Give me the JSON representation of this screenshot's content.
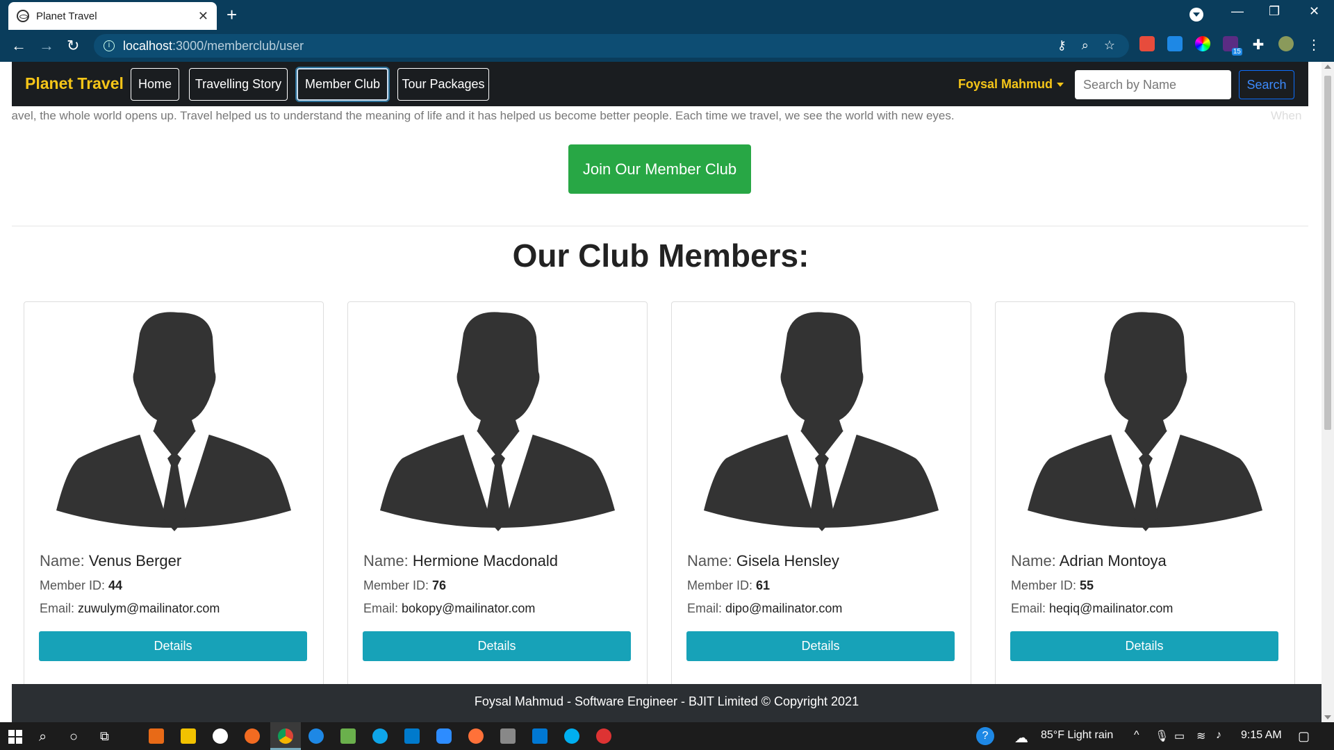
{
  "browser": {
    "tab_title": "Planet Travel",
    "tab_close": "✕",
    "new_tab": "+",
    "url_host": "localhost",
    "url_path": ":3000/memberclub/user",
    "extension_badge": "15"
  },
  "navbar": {
    "brand": "Planet Travel",
    "links": [
      "Home",
      "Travelling Story",
      "Member Club",
      "Tour Packages"
    ],
    "user_name": "Foysal Mahmud",
    "search_placeholder": "Search by Name",
    "search_button": "Search"
  },
  "marquee": {
    "text": "u travel, the whole world opens up. Travel helped us to understand the meaning of life and it has helped us become better people. Each time we travel, we see the world with new eyes.",
    "tail": "When"
  },
  "join_button": "Join Our Member Club",
  "heading": "Our Club Members:",
  "labels": {
    "name": "Name:",
    "member_id": "Member ID:",
    "email": "Email:",
    "details": "Details"
  },
  "members": [
    {
      "name": "Venus Berger",
      "id": "44",
      "email": "zuwulym@mailinator.com"
    },
    {
      "name": "Hermione Macdonald",
      "id": "76",
      "email": "bokopy@mailinator.com"
    },
    {
      "name": "Gisela Hensley",
      "id": "61",
      "email": "dipo@mailinator.com"
    },
    {
      "name": "Adrian Montoya",
      "id": "55",
      "email": "heqiq@mailinator.com"
    }
  ],
  "footer": "Foysal Mahmud - Software Engineer - BJIT Limited © Copyright 2021",
  "taskbar": {
    "weather": "85°F  Light rain",
    "time": "9:15 AM"
  },
  "colors": {
    "browser_frame": "#0a3d5c",
    "navbar_bg": "#1a1d20",
    "brand": "#f5c518",
    "join_button": "#28a745",
    "details_button": "#17a2b8",
    "footer_bg": "#2b2f33"
  }
}
